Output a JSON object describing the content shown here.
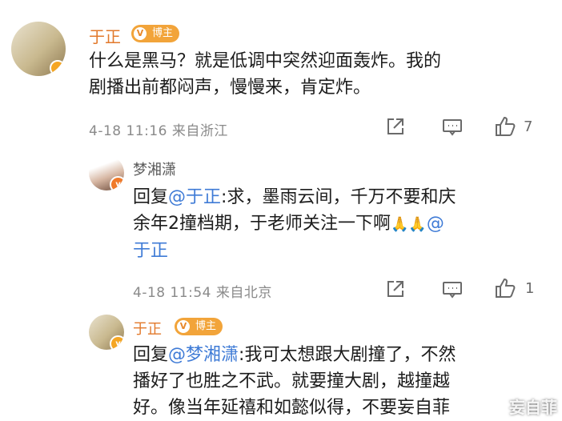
{
  "comments": [
    {
      "username": "于正",
      "badge": "博主",
      "text_lines": [
        "什么是黑马？就是低调中突然迎面轰炸。我的",
        "剧播出前都闷声，慢慢来，肯定炸。"
      ],
      "timestamp": "4-18 11:16 来自浙江",
      "likes": "7"
    },
    {
      "username": "梦湘潇",
      "reply_prefix": "回复",
      "mention": "@于正",
      "text_lines": [
        ":求，墨雨云间，千万不要和庆",
        "余年2撞档期，于老师关注一下啊",
        "@",
        "于正"
      ],
      "emoji": "🙏🙏",
      "timestamp": "4-18 11:54 来自北京",
      "likes": "1"
    },
    {
      "username": "于正",
      "badge": "博主",
      "reply_prefix": "回复",
      "mention": "@梦湘潇",
      "text_lines": [
        ":我可太想跟大剧撞了，不然",
        "播好了也胜之不武。就要撞大剧，越撞越",
        "好。像当年延禧和如懿似得，不要妄自菲"
      ]
    }
  ],
  "watermark": "妄自菲",
  "colors": {
    "username": "#e2792b",
    "mention": "#3f7bd6",
    "badge_bg": "#f2a43a",
    "meta": "#8a8a8a"
  }
}
